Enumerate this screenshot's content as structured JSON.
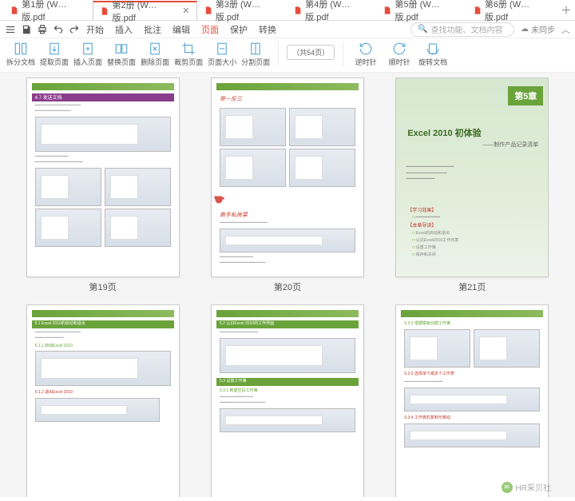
{
  "tabs": [
    {
      "label": "第1册 (W…版.pdf"
    },
    {
      "label": "第2册 (W…版.pdf"
    },
    {
      "label": "第3册 (W…版.pdf"
    },
    {
      "label": "第4册 (W…版.pdf"
    },
    {
      "label": "第5册 (W…版.pdf"
    },
    {
      "label": "第6册 (W…版.pdf"
    }
  ],
  "tabs_active_index": 1,
  "menu": {
    "items": [
      "开始",
      "插入",
      "批注",
      "编辑",
      "页面",
      "保护",
      "转换"
    ],
    "active_index": 4
  },
  "search": {
    "placeholder": "查找功能、文档内容"
  },
  "sync": {
    "label": "未同步"
  },
  "toolbar": {
    "items": [
      {
        "name": "split-doc",
        "label": "拆分文档"
      },
      {
        "name": "extract-page",
        "label": "提取页面"
      },
      {
        "name": "insert-page",
        "label": "插入页面"
      },
      {
        "name": "replace-page",
        "label": "替换页面"
      },
      {
        "name": "delete-page",
        "label": "删除页面"
      },
      {
        "name": "crop-page",
        "label": "裁剪页面"
      },
      {
        "name": "page-size",
        "label": "页面大小"
      },
      {
        "name": "split-page",
        "label": "分割页面"
      }
    ],
    "page_counter": "（共54页）",
    "rotate": [
      {
        "name": "ccw",
        "label": "逆时针"
      },
      {
        "name": "cw",
        "label": "顺时针"
      },
      {
        "name": "rotate-doc",
        "label": "旋转文档"
      }
    ]
  },
  "pages": {
    "row1": [
      {
        "num": "第19页",
        "section": "4.7 发送文档"
      },
      {
        "num": "第20页",
        "section_top": "举一反三",
        "section_mid": "高手私房菜"
      },
      {
        "num": "第21页",
        "chapter_no": "第5章",
        "chapter_title": "Excel 2010 初体验",
        "chapter_sub": "——制作产品记录清单",
        "tags": [
          "【学习效果】",
          "【本章导读】"
        ],
        "bullets": [
          "Excel的启动和退出",
          "认识Excel2010工作环境",
          "设置工作簿",
          "保存和关闭"
        ]
      }
    ],
    "row2": [
      {
        "section_a": "5.1 Excel 2010的启动和退出",
        "section_b": "5.1.1 启动Excel 2010",
        "section_c": "5.1.2 退出Excel 2010"
      },
      {
        "section_a": "5.2 认识Excel 2010的工作界面",
        "section_b": "5.3 设置工作簿",
        "section_c": "5.3.1 新建空白工作簿"
      },
      {
        "section_a": "5.3.2 根据模板创建工作簿",
        "section_b": "5.3.3 选择单个或多个工作表",
        "section_c": "5.3.4 工作表的复制与移动"
      }
    ]
  },
  "watermark": {
    "label": "HR采贝社"
  }
}
